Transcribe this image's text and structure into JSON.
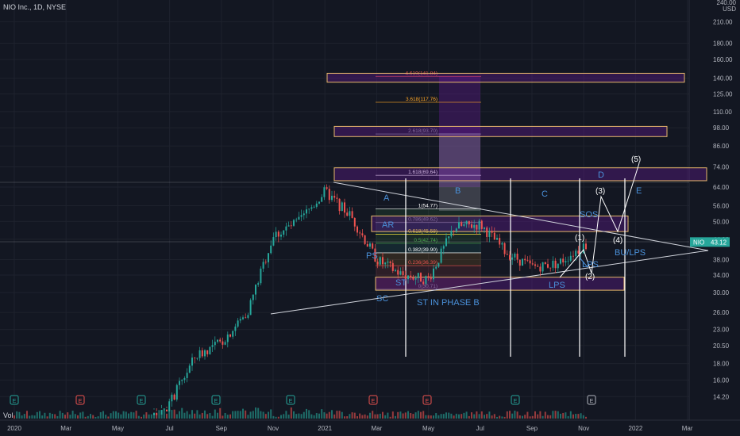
{
  "header": {
    "symbol_line": "NIO Inc., 1D, NYSE",
    "currency": "240.00 USD",
    "volume_label": "Vol"
  },
  "colors": {
    "background": "#131722",
    "candle_up": "#26a69a",
    "candle_down": "#ef5350",
    "zone_fill": "#6a1b9a",
    "zone_border": "#e8b86b",
    "label_blue": "#4a90d9",
    "price_tag": "#26a69a"
  },
  "chart_data": {
    "type": "candlestick",
    "title": "NIO Inc., 1D, NYSE",
    "y_scale": "log",
    "ylim": [
      13,
      240
    ],
    "y_ticks": [
      "210.00",
      "180.00",
      "160.00",
      "140.00",
      "125.00",
      "110.00",
      "98.00",
      "86.00",
      "74.00",
      "64.00",
      "56.00",
      "50.00",
      "44.00",
      "38.00",
      "34.00",
      "30.00",
      "26.00",
      "23.00",
      "20.50",
      "18.00",
      "16.00",
      "14.20"
    ],
    "x_ticks": [
      "2020",
      "Mar",
      "May",
      "Jul",
      "Sep",
      "Nov",
      "2021",
      "Mar",
      "May",
      "Jul",
      "Sep",
      "Nov",
      "2022",
      "Mar"
    ],
    "last_price": {
      "label": "NIO",
      "value": "43.12"
    },
    "price_path": [
      [
        "2020-01",
        3.8
      ],
      [
        "2020-06",
        11.5
      ],
      [
        "2020-07",
        13.5
      ],
      [
        "2020-08",
        19
      ],
      [
        "2020-09",
        21
      ],
      [
        "2020-10",
        26
      ],
      [
        "2020-11",
        45
      ],
      [
        "2020-12",
        50
      ],
      [
        "2021-01",
        62
      ],
      [
        "2021-02",
        52
      ],
      [
        "2021-03",
        38
      ],
      [
        "2021-04",
        34
      ],
      [
        "2021-05",
        33
      ],
      [
        "2021-06",
        48
      ],
      [
        "2021-07",
        49
      ],
      [
        "2021-08",
        40
      ],
      [
        "2021-09",
        36
      ],
      [
        "2021-10",
        37
      ],
      [
        "2021-11",
        42
      ],
      [
        "2021-12",
        43
      ]
    ],
    "fib_levels": [
      {
        "label": "4.619(141.84)",
        "value": 141.84
      },
      {
        "label": "3.618(117.76)",
        "value": 117.76
      },
      {
        "label": "2.618(93.70)",
        "value": 93.7
      },
      {
        "label": "1.618(69.64)",
        "value": 69.64
      },
      {
        "label": "1(54.77)",
        "value": 54.77
      },
      {
        "label": "0.786(49.62)",
        "value": 49.62
      },
      {
        "label": "0.618(45.58)",
        "value": 45.58
      },
      {
        "label": "0.5(42.74)",
        "value": 42.74
      },
      {
        "label": "0.382(39.90)",
        "value": 39.9
      },
      {
        "label": "0.236(36.39)",
        "value": 36.39
      },
      {
        "label": "0(30.71)",
        "value": 30.71
      }
    ],
    "annotations": {
      "wyckoff": [
        "SC",
        "PS",
        "AR",
        "ST",
        "ST IN PHASE B",
        "LPS",
        "LPS",
        "SOS",
        "BU/LPS"
      ],
      "phases": [
        "A",
        "B",
        "C",
        "D",
        "E"
      ],
      "waves": [
        "(1)",
        "(2)",
        "(3)",
        "(4)",
        "(5)"
      ]
    },
    "earnings_markers": [
      "E",
      "E",
      "E",
      "E",
      "E",
      "E",
      "E",
      "E",
      "E",
      "E",
      "E"
    ]
  }
}
